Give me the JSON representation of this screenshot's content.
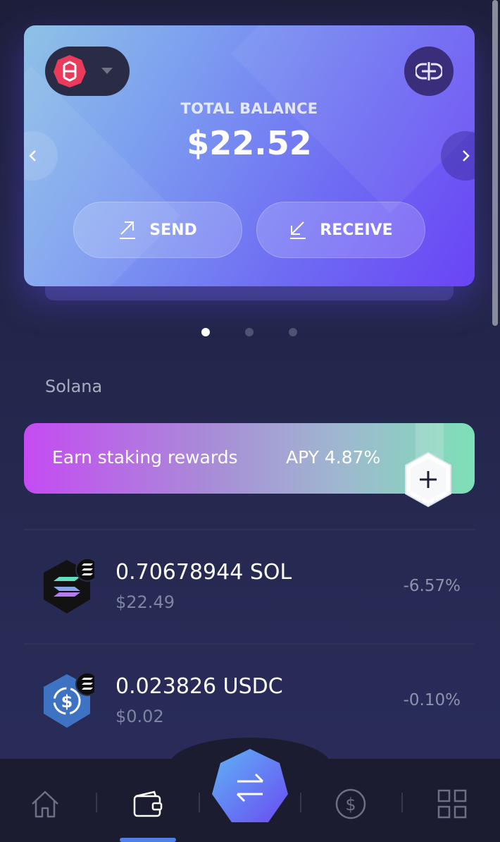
{
  "card": {
    "balance_label": "TOTAL BALANCE",
    "balance_value": "$22.52",
    "send_label": "SEND",
    "receive_label": "RECEIVE"
  },
  "pager": {
    "pages": 3,
    "active": 0
  },
  "section": {
    "title": "Solana"
  },
  "staking": {
    "text": "Earn staking rewards",
    "apy": "APY 4.87%"
  },
  "tokens": [
    {
      "amount": "0.70678944 SOL",
      "usd": "$22.49",
      "change": "-6.57%"
    },
    {
      "amount": "0.023826 USDC",
      "usd": "$0.02",
      "change": "-0.10%"
    }
  ],
  "nav": {
    "items": [
      "home-icon",
      "wallet-icon",
      "swap-icon",
      "dollar-icon",
      "apps-grid-icon"
    ],
    "active": "wallet-icon"
  },
  "colors": {
    "accent": "#6a44f5",
    "brand_red": "#ea3b5c",
    "active_nav": "#4f7fe6"
  }
}
